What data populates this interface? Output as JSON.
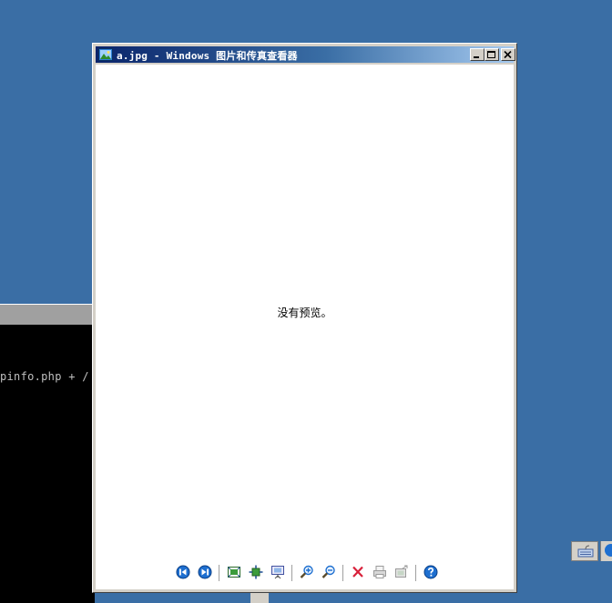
{
  "window": {
    "title": "a.jpg - Windows 图片和传真查看器",
    "icon": "image-viewer-icon",
    "buttons": [
      "minimize",
      "maximize",
      "close"
    ]
  },
  "viewer": {
    "message": "没有预览。"
  },
  "toolbar": {
    "buttons": [
      {
        "name": "previous-image",
        "icon": "prev-circle-icon"
      },
      {
        "name": "next-image",
        "icon": "next-circle-icon"
      },
      {
        "name": "best-fit",
        "icon": "best-fit-icon"
      },
      {
        "name": "actual-size",
        "icon": "actual-size-icon"
      },
      {
        "name": "slide-show",
        "icon": "slideshow-icon"
      },
      {
        "name": "zoom-in",
        "icon": "zoom-in-icon"
      },
      {
        "name": "zoom-out",
        "icon": "zoom-out-icon"
      },
      {
        "name": "delete",
        "icon": "delete-x-icon"
      },
      {
        "name": "print",
        "icon": "printer-icon"
      },
      {
        "name": "copy-to",
        "icon": "copy-to-icon"
      },
      {
        "name": "help",
        "icon": "help-icon"
      }
    ]
  },
  "console": {
    "line": "pinfo.php + /"
  },
  "colors": {
    "desktop": "#3a6ea5",
    "titlebar_start": "#0a246a",
    "titlebar_end": "#a6caf0",
    "face": "#d4d0c8"
  }
}
